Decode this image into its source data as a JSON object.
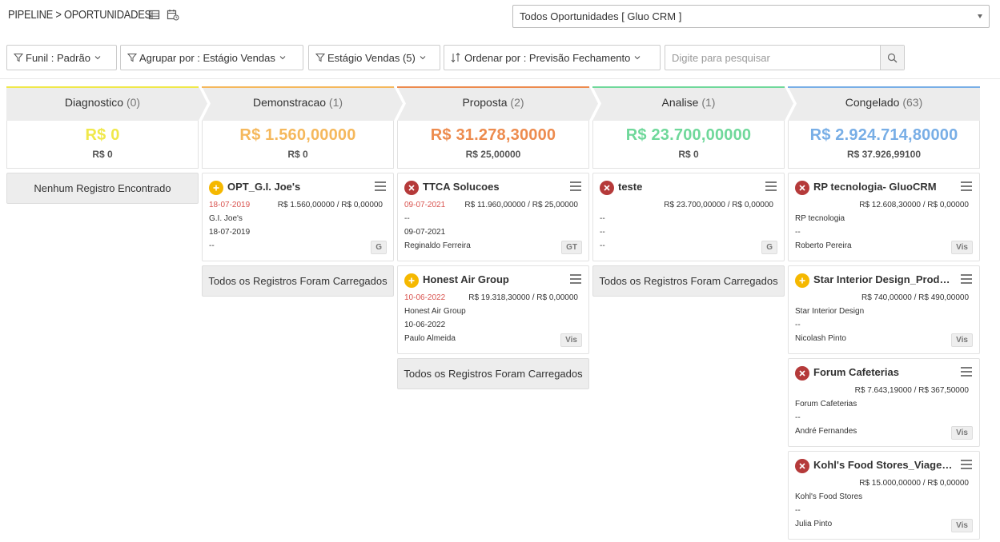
{
  "header": {
    "breadcrumb": "PIPELINE > OPORTUNIDADES",
    "pipeline_select": "Todos Oportunidades [ Gluo CRM ]"
  },
  "filters": {
    "funnel": "Funil : Padrão",
    "group_by": "Agrupar por : Estágio Vendas",
    "stages": "Estágio Vendas (5)",
    "order_by": "Ordenar por : Previsão Fechamento",
    "search_placeholder": "Digite para pesquisar"
  },
  "colors": {
    "diagnostico": "#f0e84a",
    "demonstracao": "#f5b85c",
    "proposta": "#ed8b4e",
    "analise": "#6fd89a",
    "congelado": "#78aee6"
  },
  "columns": [
    {
      "name": "Diagnostico",
      "count": "(0)",
      "total": "R$ 0",
      "subtotal": "R$ 0",
      "empty_label": "Nenhum Registro Encontrado",
      "cards": []
    },
    {
      "name": "Demonstracao",
      "count": "(1)",
      "total": "R$ 1.560,00000",
      "subtotal": "R$ 0",
      "loaded_label": "Todos os Registros Foram Carregados",
      "cards": [
        {
          "status": "plus",
          "title": "OPT_G.I. Joe's",
          "date": "18-07-2019",
          "amount": "R$ 1.560,00000 / R$ 0,00000",
          "line1": "G.I. Joe's",
          "line2": "18-07-2019",
          "line3": "--",
          "tag": "G"
        }
      ]
    },
    {
      "name": "Proposta",
      "count": "(2)",
      "total": "R$ 31.278,30000",
      "subtotal": "R$ 25,00000",
      "loaded_label": "Todos os Registros Foram Carregados",
      "cards": [
        {
          "status": "x",
          "title": "TTCA Solucoes",
          "date": "09-07-2021",
          "amount": "R$ 11.960,00000 / R$ 25,00000",
          "line1": "--",
          "line2": "09-07-2021",
          "line3": "Reginaldo Ferreira",
          "tag": "GT"
        },
        {
          "status": "plus",
          "title": "Honest Air Group",
          "date": "10-06-2022",
          "amount": "R$ 19.318,30000 / R$ 0,00000",
          "line1": "Honest Air Group",
          "line2": "10-06-2022",
          "line3": "Paulo Almeida",
          "tag": "Vis"
        }
      ]
    },
    {
      "name": "Analise",
      "count": "(1)",
      "total": "R$ 23.700,00000",
      "subtotal": "R$ 0",
      "loaded_label": "Todos os Registros Foram Carregados",
      "cards": [
        {
          "status": "x",
          "title": "teste",
          "date": "",
          "amount": "R$ 23.700,00000 / R$ 0,00000",
          "line1": "--",
          "line2": "--",
          "line3": "--",
          "tag": "G"
        }
      ]
    },
    {
      "name": "Congelado",
      "count": "(63)",
      "total": "R$ 2.924.714,80000",
      "subtotal": "R$ 37.926,99100",
      "cards": [
        {
          "status": "x",
          "title": "RP tecnologia- GluoCRM",
          "date": "",
          "amount": "R$ 12.608,30000 / R$ 0,00000",
          "line1": "RP tecnologia",
          "line2": "--",
          "line3": "Roberto Pereira",
          "tag": "Vis"
        },
        {
          "status": "plus",
          "title": "Star Interior Design_Produtos",
          "date": "",
          "amount": "R$ 740,00000 / R$ 490,00000",
          "line1": "Star Interior Design",
          "line2": "--",
          "line3": "Nicolash Pinto",
          "tag": "Vis"
        },
        {
          "status": "x",
          "title": "Forum Cafeterias",
          "date": "",
          "amount": "R$ 7.643,19000 / R$ 367,50000",
          "line1": "Forum Cafeterias",
          "line2": "--",
          "line3": "André Fernandes",
          "tag": "Vis"
        },
        {
          "status": "x",
          "title": "Kohl's Food Stores_Viagem corporativa",
          "date": "",
          "amount": "R$ 15.000,00000 / R$ 0,00000",
          "line1": "Kohl's Food Stores",
          "line2": "--",
          "line3": "Julia Pinto",
          "tag": "Vis"
        }
      ]
    }
  ]
}
